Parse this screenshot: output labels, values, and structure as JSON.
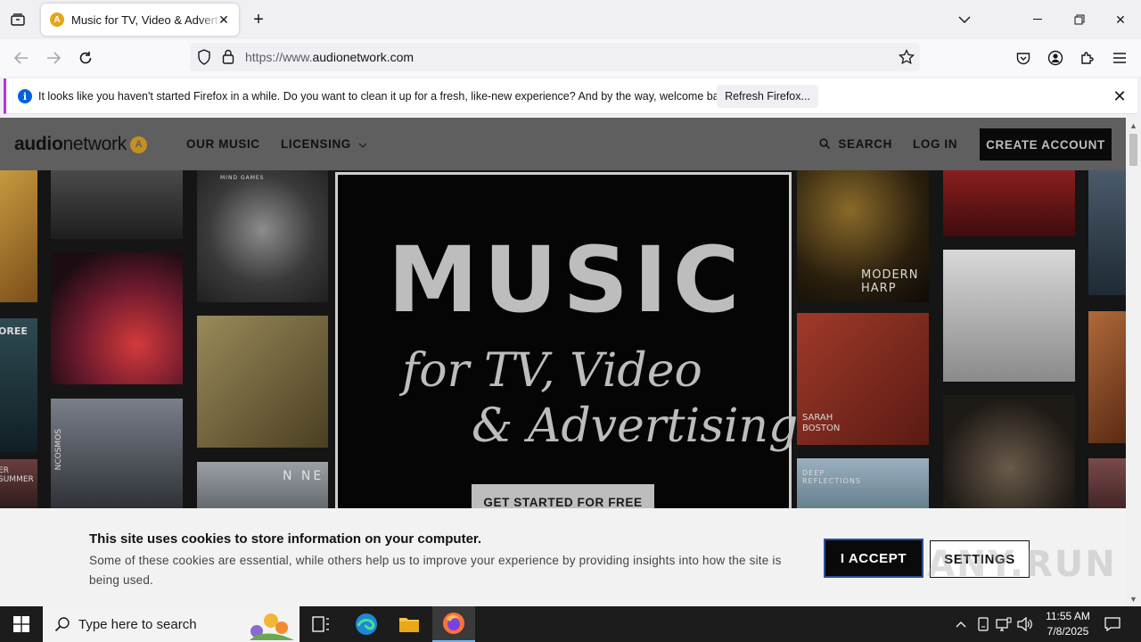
{
  "browser": {
    "tab": {
      "title": "Music for TV, Video & Advertising | Audio Network",
      "favicon": "audio-network-favicon"
    },
    "url": {
      "prefix": "https://www.",
      "domain": "audionetwork.com"
    },
    "notification": {
      "text": "It looks like you haven't started Firefox in a while. Do you want to clean it up for a fresh, like-new experience? And by the way, welcome back!",
      "button_label": "Refresh Firefox..."
    }
  },
  "site": {
    "logo": {
      "part1": "audio",
      "part2": "network"
    },
    "nav": {
      "our_music": "OUR MUSIC",
      "licensing": "LICENSING",
      "search": "SEARCH",
      "login": "LOG IN",
      "create_account": "CREATE ACCOUNT"
    },
    "hero": {
      "headline": "MUSIC",
      "line2": "for TV, Video",
      "line3": "& Advertising",
      "cta": "GET STARTED FOR FREE"
    },
    "album_tiles": {
      "mind_games": "MIND GAMES",
      "modern_harp": "MODERN HARP",
      "nne": "N NE",
      "sarah_boston": "SARAH BOSTON",
      "deep_reflections": "DEEP REFLECTIONS",
      "summer": "ER SUMMER",
      "oree": "OREE",
      "ncosmos": "NCOSMOS"
    },
    "cookie_banner": {
      "title": "This site uses cookies to store information on your computer.",
      "text": "Some of these cookies are essential, while others help us to improve your experience by providing insights into how the site is being used.",
      "accept": "I ACCEPT",
      "settings": "SETTINGS"
    },
    "watermark": "ANY.RUN"
  },
  "taskbar": {
    "search_placeholder": "Type here to search",
    "time": "11:55 AM",
    "date": "7/8/2025"
  },
  "colors": {
    "accent": "#c49020",
    "header_bg": "#5f5f5f",
    "accept_border": "#2b4ea0"
  }
}
